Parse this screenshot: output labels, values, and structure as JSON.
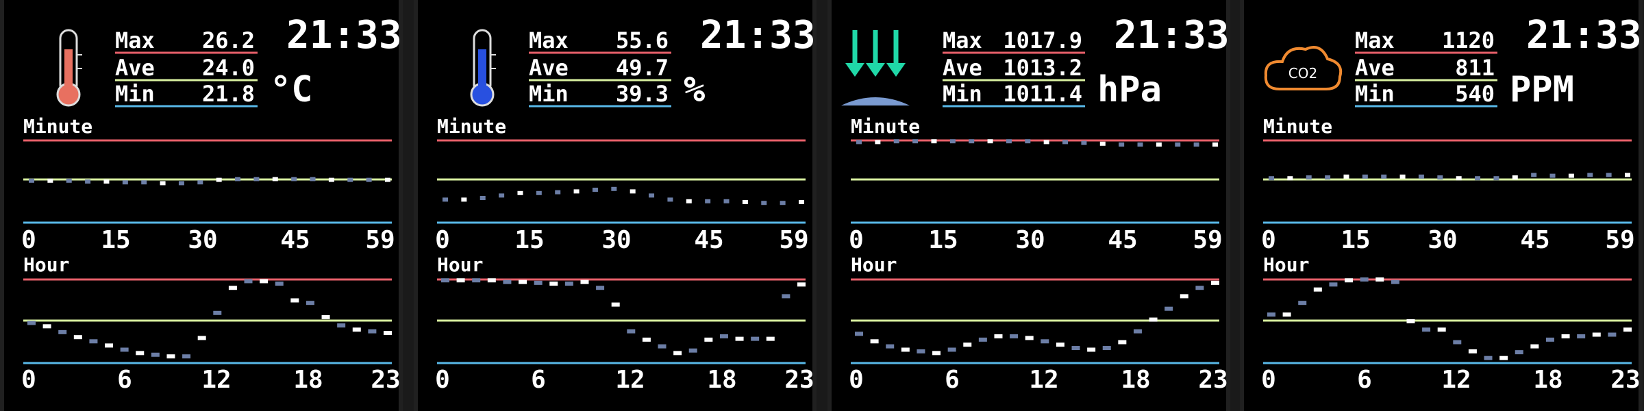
{
  "colors": {
    "background": "#000000",
    "max_line": "#e8606a",
    "ave_line": "#d8f0a0",
    "min_line": "#58b8e8",
    "text": "#ffffff",
    "dot": "#6c7ea6"
  },
  "labels": {
    "max": "Max",
    "ave": "Ave",
    "min": "Min",
    "minute_section": "Minute",
    "hour_section": "Hour"
  },
  "minute_ticks": [
    "0",
    "15",
    "30",
    "45",
    "59"
  ],
  "hour_ticks": [
    "0",
    "6",
    "12",
    "18",
    "23"
  ],
  "panels": [
    {
      "icon": "thermometer-red-icon",
      "time": "21:33",
      "unit": "°C",
      "max": "26.2",
      "ave": "24.0",
      "min": "21.8",
      "minute_dots": [
        0.51,
        0.51,
        0.51,
        0.5,
        0.5,
        0.49,
        0.49,
        0.48,
        0.48,
        0.49,
        0.52,
        0.53,
        0.53,
        0.53,
        0.53,
        0.53,
        0.52,
        0.52,
        0.52,
        0.52
      ],
      "hour_dots": [
        0.48,
        0.44,
        0.37,
        0.31,
        0.26,
        0.21,
        0.16,
        0.12,
        0.1,
        0.08,
        0.08,
        0.3,
        0.6,
        0.9,
        0.98,
        0.98,
        0.95,
        0.75,
        0.72,
        0.55,
        0.45,
        0.4,
        0.38,
        0.36
      ]
    },
    {
      "icon": "thermometer-blue-icon",
      "time": "21:33",
      "unit": "%",
      "max": "55.6",
      "ave": "49.7",
      "min": "39.3",
      "minute_dots": [
        0.28,
        0.28,
        0.3,
        0.33,
        0.36,
        0.36,
        0.37,
        0.38,
        0.4,
        0.41,
        0.38,
        0.33,
        0.28,
        0.26,
        0.26,
        0.26,
        0.25,
        0.24,
        0.24,
        0.25
      ],
      "hour_dots": [
        0.99,
        0.99,
        0.99,
        0.99,
        0.97,
        0.97,
        0.96,
        0.95,
        0.95,
        0.97,
        0.9,
        0.7,
        0.38,
        0.28,
        0.2,
        0.12,
        0.15,
        0.28,
        0.32,
        0.29,
        0.29,
        0.29,
        0.8,
        0.94
      ],
      "hour_dot_fill": [
        1,
        1,
        1,
        1,
        1,
        1,
        1,
        1,
        1,
        1,
        0,
        1,
        1,
        1,
        1,
        1,
        1,
        1,
        1,
        1,
        1,
        1,
        1,
        1
      ]
    },
    {
      "icon": "pressure-arrows-icon",
      "time": "21:33",
      "unit": "hPa",
      "max": "1017.9",
      "ave": "1013.2",
      "min": "1011.4",
      "minute_dots": [
        0.98,
        0.98,
        0.99,
        0.99,
        0.99,
        0.99,
        0.99,
        0.99,
        0.99,
        0.99,
        0.98,
        0.98,
        0.97,
        0.96,
        0.95,
        0.95,
        0.95,
        0.95,
        0.95,
        0.95
      ],
      "hour_dots": [
        0.35,
        0.26,
        0.2,
        0.16,
        0.14,
        0.12,
        0.16,
        0.22,
        0.28,
        0.32,
        0.32,
        0.3,
        0.26,
        0.22,
        0.18,
        0.16,
        0.18,
        0.25,
        0.38,
        0.52,
        0.65,
        0.8,
        0.9,
        0.96
      ]
    },
    {
      "icon": "co2-cloud-icon",
      "time": "21:33",
      "unit": "PPM",
      "max": "1120",
      "ave": "811",
      "min": "540",
      "minute_dots": [
        0.54,
        0.54,
        0.55,
        0.55,
        0.56,
        0.56,
        0.56,
        0.56,
        0.56,
        0.55,
        0.54,
        0.54,
        0.54,
        0.55,
        0.58,
        0.57,
        0.57,
        0.58,
        0.58,
        0.58
      ],
      "hour_dots": [
        0.58,
        0.58,
        0.72,
        0.88,
        0.94,
        0.99,
        1.0,
        1.0,
        0.97,
        0.5,
        0.4,
        0.4,
        0.25,
        0.14,
        0.06,
        0.06,
        0.13,
        0.2,
        0.28,
        0.32,
        0.32,
        0.34,
        0.34,
        0.4
      ]
    }
  ]
}
